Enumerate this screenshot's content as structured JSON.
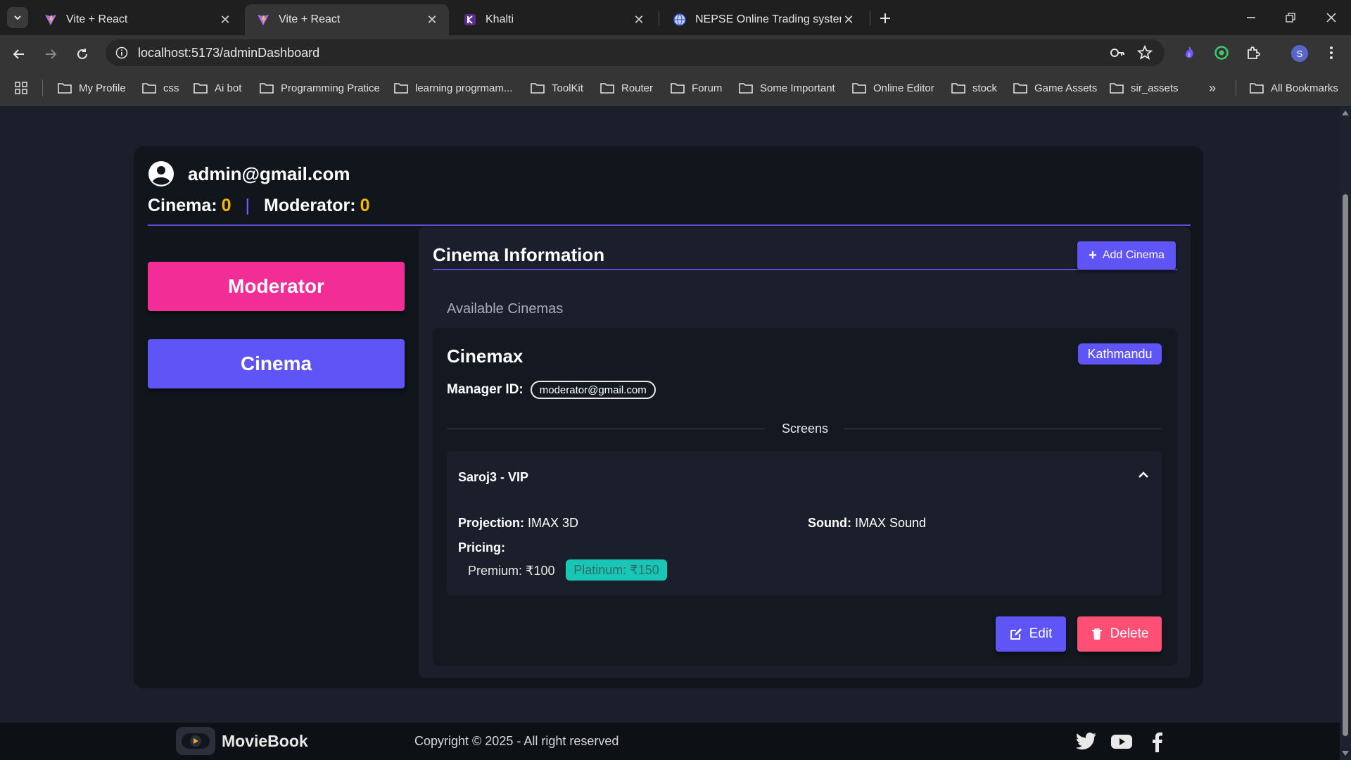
{
  "browser": {
    "tabs": [
      {
        "title": "Vite + React",
        "active": false
      },
      {
        "title": "Vite + React",
        "active": true
      },
      {
        "title": "Khalti",
        "active": false
      },
      {
        "title": "NEPSE Online Trading system",
        "active": false
      }
    ],
    "url": "localhost:5173/adminDashboard",
    "profile_initial": "S",
    "bookmarks": [
      "My Profile",
      "css",
      "Ai bot",
      "Programming Pratice",
      "learning progrmam...",
      "ToolKit",
      "Router",
      "Forum",
      "Some Important",
      "Online Editor",
      "stock",
      "Game Assets",
      "sir_assets"
    ],
    "bookmarks_overflow": "»",
    "all_bookmarks": "All Bookmarks"
  },
  "dashboard": {
    "user_email": "admin@gmail.com",
    "cinema_label": "Cinema:",
    "cinema_count": "0",
    "moderator_label": "Moderator:",
    "moderator_count": "0",
    "separator": "|",
    "sidebar": {
      "moderator_button": "Moderator",
      "cinema_button": "Cinema"
    },
    "section_title": "Cinema Information",
    "add_button": "Add Cinema",
    "available_label": "Available Cinemas",
    "cinema": {
      "name": "Cinemax",
      "location": "Kathmandu",
      "manager_label": "Manager ID:",
      "manager_id": "moderator@gmail.com",
      "screens_label": "Screens",
      "screen": {
        "name": "Saroj3 - VIP",
        "projection_label": "Projection:",
        "projection": "IMAX 3D",
        "sound_label": "Sound:",
        "sound": "IMAX Sound",
        "pricing_label": "Pricing:",
        "premium": "Premium: ₹100",
        "platinum": "Platinum: ₹150"
      },
      "edit_button": "Edit",
      "delete_button": "Delete"
    }
  },
  "footer": {
    "brand": "MovieBook",
    "copyright": "Copyright © 2025 - All right reserved"
  },
  "colors": {
    "accent": "#5f55f6",
    "moderator": "#f32d96",
    "delete": "#ff4f74",
    "count": "#f5b700",
    "platinum": "#19c6b6"
  }
}
